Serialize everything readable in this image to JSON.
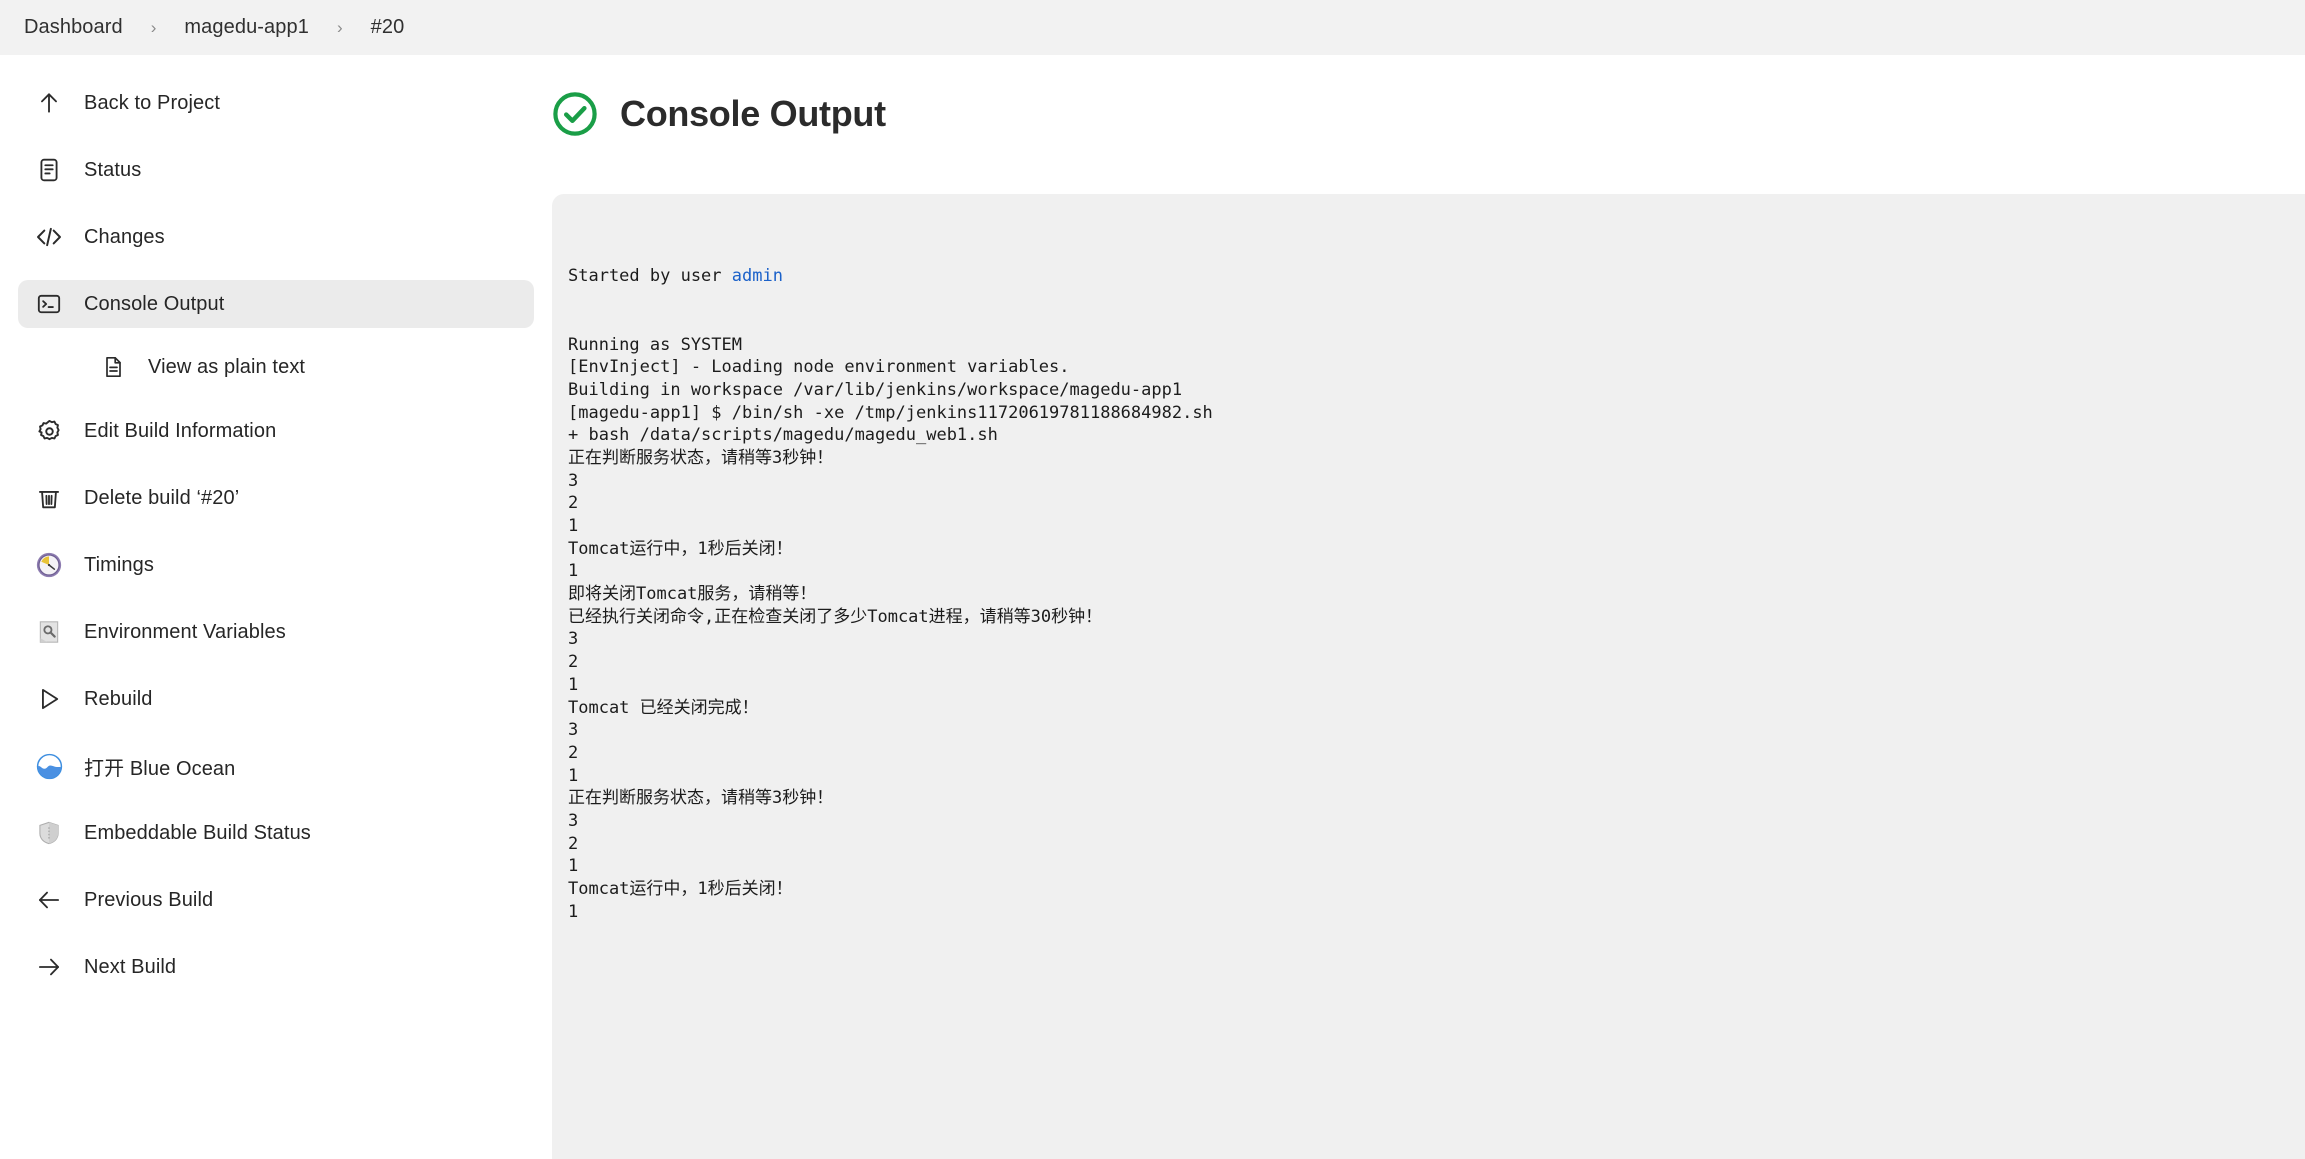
{
  "breadcrumb": {
    "items": [
      {
        "label": "Dashboard",
        "name": "breadcrumb-dashboard"
      },
      {
        "label": "magedu-app1",
        "name": "breadcrumb-project"
      },
      {
        "label": "#20",
        "name": "breadcrumb-build"
      }
    ],
    "separator": "›"
  },
  "sidebar": {
    "items": [
      {
        "label": "Back to Project",
        "icon": "arrow-up-icon"
      },
      {
        "label": "Status",
        "icon": "document-status-icon"
      },
      {
        "label": "Changes",
        "icon": "code-brackets-icon"
      },
      {
        "label": "Console Output",
        "icon": "terminal-icon",
        "selected": true
      },
      {
        "label": "View as plain text",
        "icon": "plain-text-document-icon",
        "sub": true
      },
      {
        "label": "Edit Build Information",
        "icon": "gear-icon"
      },
      {
        "label": "Delete build ‘#20’",
        "icon": "trash-icon"
      },
      {
        "label": "Timings",
        "icon": "clock-icon"
      },
      {
        "label": "Environment Variables",
        "icon": "environment-variables-icon"
      },
      {
        "label": "Rebuild",
        "icon": "play-icon"
      },
      {
        "label": "打开 Blue Ocean",
        "icon": "blue-ocean-icon"
      },
      {
        "label": "Embeddable Build Status",
        "icon": "shield-icon"
      },
      {
        "label": "Previous Build",
        "icon": "arrow-left-icon"
      },
      {
        "label": "Next Build",
        "icon": "arrow-right-icon"
      }
    ]
  },
  "main": {
    "title": "Console Output",
    "status": "success",
    "status_icon": "green-check-circle-icon",
    "status_color": "#1a9e47",
    "link_color": "#1b61c9",
    "console_bg": "#f0f0f0"
  },
  "console": {
    "started_by_prefix": "Started by user ",
    "started_by_user": "admin",
    "lines": [
      "Running as SYSTEM",
      "[EnvInject] - Loading node environment variables.",
      "Building in workspace /var/lib/jenkins/workspace/magedu-app1",
      "[magedu-app1] $ /bin/sh -xe /tmp/jenkins11720619781188684982.sh",
      "+ bash /data/scripts/magedu/magedu_web1.sh",
      "正在判断服务状态，请稍等3秒钟！",
      "3",
      "2",
      "1",
      "Tomcat运行中，1秒后关闭！",
      "1",
      "即将关闭Tomcat服务，请稍等！",
      "已经执行关闭命令,正在检查关闭了多少Tomcat进程，请稍等30秒钟！",
      "3",
      "2",
      "1",
      "Tomcat 已经关闭完成！",
      "3",
      "2",
      "1",
      "正在判断服务状态，请稍等3秒钟！",
      "3",
      "2",
      "1",
      "Tomcat运行中，1秒后关闭！",
      "1"
    ]
  }
}
